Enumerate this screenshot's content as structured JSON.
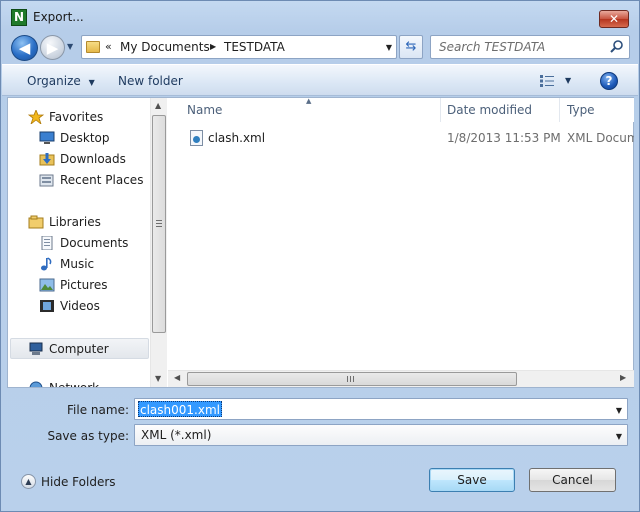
{
  "window": {
    "title": "Export...",
    "app_icon_letter": "N",
    "close_glyph": "✕"
  },
  "navigation": {
    "back_glyph": "◀",
    "forward_glyph": "▶",
    "address": {
      "overflow_glyph": "«",
      "segments": [
        "My Documents",
        "TESTDATA"
      ],
      "separator_glyph": "▶"
    },
    "search": {
      "placeholder": "Search TESTDATA"
    }
  },
  "toolbar": {
    "organize_label": "Organize",
    "new_folder_label": "New folder",
    "help_glyph": "?"
  },
  "sidebar": {
    "items": [
      {
        "label": "Favorites",
        "icon": "star-icon",
        "type": "group"
      },
      {
        "label": "Desktop",
        "icon": "desktop-icon",
        "type": "item"
      },
      {
        "label": "Downloads",
        "icon": "downloads-icon",
        "type": "item"
      },
      {
        "label": "Recent Places",
        "icon": "recent-places-icon",
        "type": "item"
      },
      {
        "label": "Libraries",
        "icon": "libraries-icon",
        "type": "group"
      },
      {
        "label": "Documents",
        "icon": "documents-icon",
        "type": "item"
      },
      {
        "label": "Music",
        "icon": "music-icon",
        "type": "item"
      },
      {
        "label": "Pictures",
        "icon": "pictures-icon",
        "type": "item"
      },
      {
        "label": "Videos",
        "icon": "videos-icon",
        "type": "item"
      },
      {
        "label": "Computer",
        "icon": "computer-icon",
        "type": "group",
        "selected": true
      },
      {
        "label": "Network",
        "icon": "network-icon",
        "type": "group",
        "partially_visible": true
      }
    ]
  },
  "file_list": {
    "columns": [
      "Name",
      "Date modified",
      "Type"
    ],
    "files": [
      {
        "name": "clash.xml",
        "date_modified": "1/8/2013 11:53 PM",
        "type": "XML Docum"
      }
    ]
  },
  "form": {
    "file_name_label": "File name:",
    "file_name_value": "clash001.xml",
    "save_as_type_label": "Save as type:",
    "save_as_type_value": "XML (*.xml)"
  },
  "footer": {
    "hide_folders_label": "Hide Folders",
    "save_label": "Save",
    "cancel_label": "Cancel"
  },
  "colors": {
    "selection": "#3399ff",
    "window_frame": "#b9d0eb",
    "close_button": "#c8533f"
  }
}
